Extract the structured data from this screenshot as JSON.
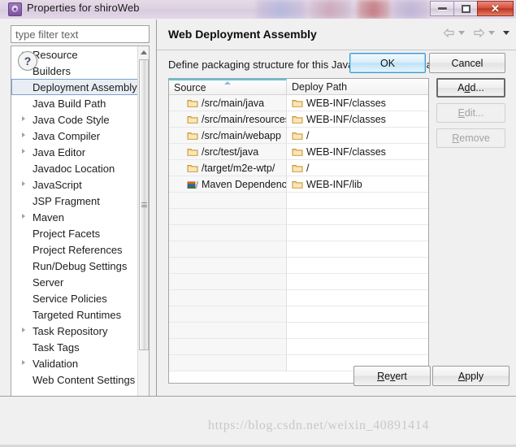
{
  "window": {
    "title": "Properties for shiroWeb",
    "icon": "gear-icon",
    "minimize_label": "Minimize",
    "maximize_label": "Maximize",
    "close_label": "Close"
  },
  "filter": {
    "placeholder": "type filter text",
    "value": ""
  },
  "tree": {
    "items": [
      {
        "label": "Resource",
        "expandable": true,
        "selected": false
      },
      {
        "label": "Builders",
        "expandable": false,
        "selected": false
      },
      {
        "label": "Deployment Assembly",
        "expandable": false,
        "selected": true
      },
      {
        "label": "Java Build Path",
        "expandable": false,
        "selected": false
      },
      {
        "label": "Java Code Style",
        "expandable": true,
        "selected": false
      },
      {
        "label": "Java Compiler",
        "expandable": true,
        "selected": false
      },
      {
        "label": "Java Editor",
        "expandable": true,
        "selected": false
      },
      {
        "label": "Javadoc Location",
        "expandable": false,
        "selected": false
      },
      {
        "label": "JavaScript",
        "expandable": true,
        "selected": false
      },
      {
        "label": "JSP Fragment",
        "expandable": false,
        "selected": false
      },
      {
        "label": "Maven",
        "expandable": true,
        "selected": false
      },
      {
        "label": "Project Facets",
        "expandable": false,
        "selected": false
      },
      {
        "label": "Project References",
        "expandable": false,
        "selected": false
      },
      {
        "label": "Run/Debug Settings",
        "expandable": false,
        "selected": false
      },
      {
        "label": "Server",
        "expandable": false,
        "selected": false
      },
      {
        "label": "Service Policies",
        "expandable": false,
        "selected": false
      },
      {
        "label": "Targeted Runtimes",
        "expandable": false,
        "selected": false
      },
      {
        "label": "Task Repository",
        "expandable": true,
        "selected": false
      },
      {
        "label": "Task Tags",
        "expandable": false,
        "selected": false
      },
      {
        "label": "Validation",
        "expandable": true,
        "selected": false
      },
      {
        "label": "Web Content Settings",
        "expandable": false,
        "selected": false
      }
    ]
  },
  "page": {
    "title": "Web Deployment Assembly",
    "description": "Define packaging structure for this Java EE Web Application project.",
    "nav": {
      "back_icon": "arrow-left-icon",
      "back_menu_icon": "chevron-down-icon",
      "forward_icon": "arrow-right-icon",
      "forward_menu_icon": "chevron-down-icon",
      "view_menu_icon": "chevron-down-icon"
    }
  },
  "table": {
    "columns": [
      "Source",
      "Deploy Path"
    ],
    "sorted_column": "Source",
    "rows": [
      {
        "source": "/src/main/java",
        "source_icon": "folder-icon",
        "deploy": "WEB-INF/classes",
        "deploy_icon": "folder-icon"
      },
      {
        "source": "/src/main/resources",
        "source_icon": "folder-icon",
        "deploy": "WEB-INF/classes",
        "deploy_icon": "folder-icon"
      },
      {
        "source": "/src/main/webapp",
        "source_icon": "folder-icon",
        "deploy": "/",
        "deploy_icon": "folder-icon"
      },
      {
        "source": "/src/test/java",
        "source_icon": "folder-icon",
        "deploy": "WEB-INF/classes",
        "deploy_icon": "folder-icon"
      },
      {
        "source": "/target/m2e-wtp/",
        "source_icon": "folder-icon",
        "deploy": "/",
        "deploy_icon": "folder-icon"
      },
      {
        "source": "Maven Dependencies",
        "source_icon": "library-icon",
        "deploy": "WEB-INF/lib",
        "deploy_icon": "folder-icon"
      }
    ],
    "empty_row_count": 11
  },
  "side_buttons": [
    {
      "label": "Add...",
      "mnemonic": "d",
      "enabled": true,
      "default": true
    },
    {
      "label": "Edit...",
      "mnemonic": "E",
      "enabled": false,
      "default": false
    },
    {
      "label": "Remove",
      "mnemonic": "R",
      "enabled": false,
      "default": false
    }
  ],
  "apply_buttons": {
    "revert": {
      "label": "Revert",
      "mnemonic": "v"
    },
    "apply": {
      "label": "Apply",
      "mnemonic": "A"
    }
  },
  "footer": {
    "help_label": "?",
    "ok_label": "OK",
    "cancel_label": "Cancel",
    "watermark": "https://blog.csdn.net/weixin_40891414"
  },
  "colors": {
    "accent": "#3c9ad6",
    "selection": "#e8eef4",
    "title_bar": "#ddd0e2",
    "close_button": "#bf3522",
    "folder_icon": "#f0b64b"
  }
}
